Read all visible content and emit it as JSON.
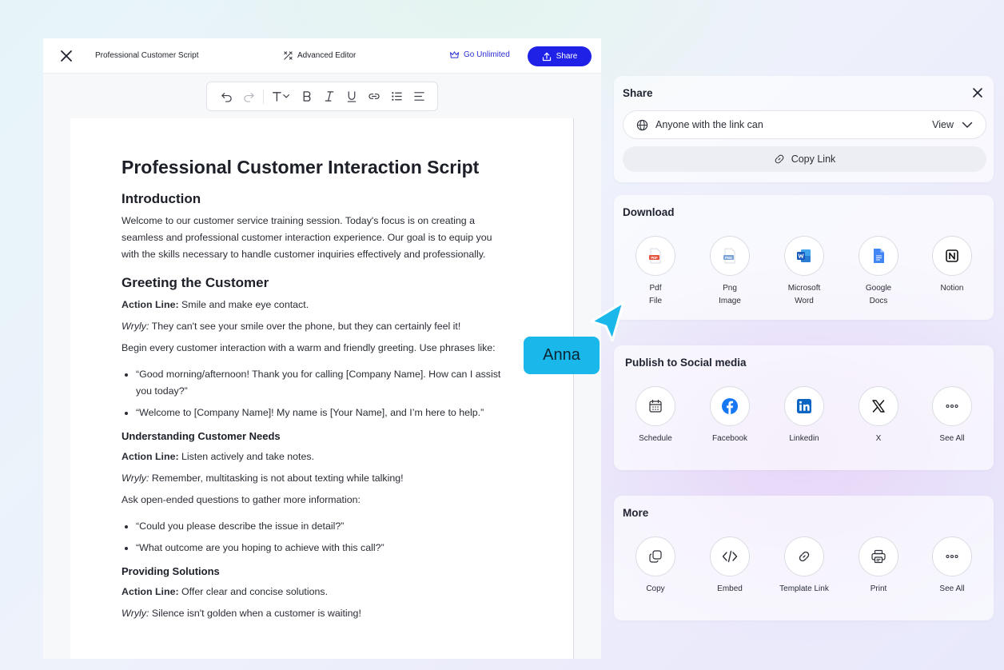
{
  "editor": {
    "doc_title": "Professional Customer Script",
    "advanced_editor": "Advanced Editor",
    "go_unlimited": "Go Unlimited",
    "share": "Share"
  },
  "document": {
    "title": "Professional Customer Interaction Script",
    "intro_heading": "Introduction",
    "intro_text": "Welcome to our customer service training session. Today's focus is on creating a seamless and professional customer interaction experience. Our goal is to equip you with the skills necessary to handle customer inquiries effectively and professionally.",
    "greeting_heading": "Greeting the Customer",
    "action_label": "Action Line:",
    "wryly_label": "Wryly:",
    "greeting_action": " Smile and make eye contact.",
    "greeting_wryly": " They can't see your smile over the phone, but they can certainly feel it!",
    "greeting_text": "Begin every customer interaction with a warm and friendly greeting. Use phrases like:",
    "greeting_bullets": [
      "“Good morning/afternoon! Thank you for calling [Company Name]. How can I assist you today?”",
      "“Welcome to [Company Name]! My name is [Your Name], and I’m here to help.”"
    ],
    "needs_heading": "Understanding Customer Needs",
    "needs_action": " Listen actively and take notes.",
    "needs_wryly": " Remember, multitasking is not about texting while talking!",
    "needs_text": "Ask open-ended questions to gather more information:",
    "needs_bullets": [
      "“Could you please describe the issue in detail?”",
      "“What outcome are you hoping to achieve with this call?”"
    ],
    "solutions_heading": "Providing Solutions",
    "solutions_action": " Offer clear and concise solutions.",
    "solutions_wryly": " Silence isn't golden when a customer is waiting!"
  },
  "share_panel": {
    "title": "Share",
    "access_text": "Anyone with the link can",
    "access_permission": "View",
    "copy_link": "Copy Link"
  },
  "download": {
    "title": "Download",
    "options": [
      "Pdf\nFile",
      "Png\nImage",
      "Microsoft\nWord",
      "Google\nDocs",
      "Notion"
    ]
  },
  "social": {
    "title": "Publish to Social media",
    "options": [
      "Schedule",
      "Facebook",
      "Linkedin",
      "X",
      "See All"
    ]
  },
  "more": {
    "title": "More",
    "options": [
      "Copy",
      "Embed",
      "Template Link",
      "Print",
      "See All"
    ]
  },
  "cursor_tag": "Anna",
  "colors": {
    "primary": "#1f22e6",
    "tag": "#1ab8ea",
    "facebook": "#1877f2",
    "linkedin": "#0a66c2",
    "word": "#185abd",
    "gdocs": "#4285f4",
    "pdf": "#e5533d"
  }
}
